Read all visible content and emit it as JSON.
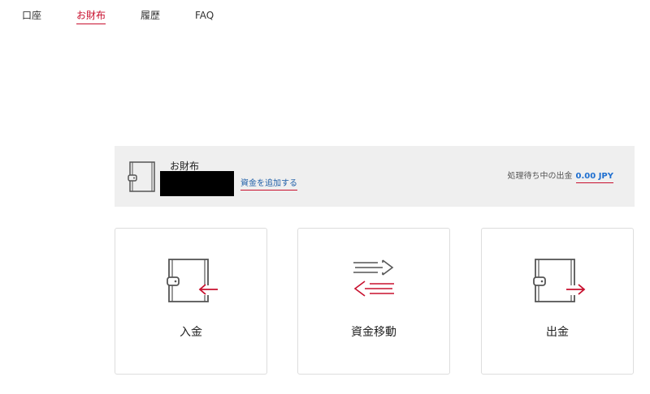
{
  "nav": {
    "items": [
      {
        "label": "口座",
        "active": false
      },
      {
        "label": "お財布",
        "active": true
      },
      {
        "label": "履歴",
        "active": false
      },
      {
        "label": "FAQ",
        "active": false
      }
    ]
  },
  "wallet": {
    "title": "お財布",
    "add_funds_label": "資金を追加する",
    "pending_label": "処理待ち中の出金",
    "pending_amount": "0.00 JPY",
    "icon": "wallet-icon"
  },
  "actions": {
    "deposit": {
      "label": "入金",
      "icon": "wallet-deposit-icon"
    },
    "transfer": {
      "label": "資金移動",
      "icon": "transfer-arrows-icon"
    },
    "withdraw": {
      "label": "出金",
      "icon": "wallet-withdraw-icon"
    }
  },
  "colors": {
    "accent": "#c8102e",
    "link": "#1f5fa8",
    "amount": "#1f6fd0",
    "bar_background": "#efefef",
    "card_border": "#dddddd"
  }
}
